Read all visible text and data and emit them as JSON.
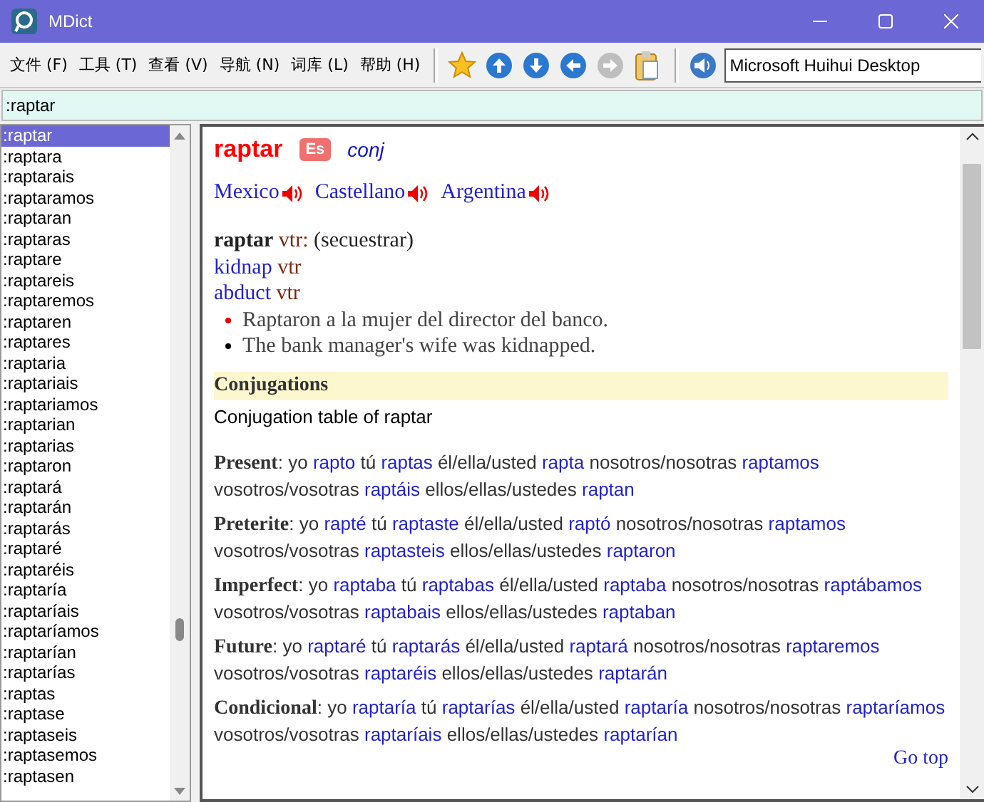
{
  "window": {
    "title": "MDict"
  },
  "menu": [
    {
      "label": "文件 (F)"
    },
    {
      "label": "工具 (T)"
    },
    {
      "label": "查看 (V)"
    },
    {
      "label": "导航 (N)"
    },
    {
      "label": "词库 (L)"
    },
    {
      "label": "帮助 (H)"
    }
  ],
  "toolbar": [
    {
      "kind": "star",
      "disabled": false
    },
    {
      "kind": "up",
      "disabled": false
    },
    {
      "kind": "down",
      "disabled": false
    },
    {
      "kind": "back",
      "disabled": false
    },
    {
      "kind": "forward",
      "disabled": true
    },
    {
      "kind": "clipboard",
      "disabled": false
    },
    {
      "kind": "speaker",
      "disabled": false
    }
  ],
  "voice_field": {
    "value": "Microsoft Huihui Desktop"
  },
  "search": {
    "value": ":raptar"
  },
  "word_list": [
    {
      "label": ":raptar",
      "selected": true
    },
    {
      "label": ":raptara",
      "selected": false
    },
    {
      "label": ":raptarais",
      "selected": false
    },
    {
      "label": ":raptaramos",
      "selected": false
    },
    {
      "label": ":raptaran",
      "selected": false
    },
    {
      "label": ":raptaras",
      "selected": false
    },
    {
      "label": ":raptare",
      "selected": false
    },
    {
      "label": ":raptareis",
      "selected": false
    },
    {
      "label": ":raptaremos",
      "selected": false
    },
    {
      "label": ":raptaren",
      "selected": false
    },
    {
      "label": ":raptares",
      "selected": false
    },
    {
      "label": ":raptaria",
      "selected": false
    },
    {
      "label": ":raptariais",
      "selected": false
    },
    {
      "label": ":raptariamos",
      "selected": false
    },
    {
      "label": ":raptarian",
      "selected": false
    },
    {
      "label": ":raptarias",
      "selected": false
    },
    {
      "label": ":raptaron",
      "selected": false
    },
    {
      "label": ":raptará",
      "selected": false
    },
    {
      "label": ":raptarán",
      "selected": false
    },
    {
      "label": ":raptarás",
      "selected": false
    },
    {
      "label": ":raptaré",
      "selected": false
    },
    {
      "label": ":raptaréis",
      "selected": false
    },
    {
      "label": ":raptaría",
      "selected": false
    },
    {
      "label": ":raptaríais",
      "selected": false
    },
    {
      "label": ":raptaríamos",
      "selected": false
    },
    {
      "label": ":raptarían",
      "selected": false
    },
    {
      "label": ":raptarías",
      "selected": false
    },
    {
      "label": ":raptas",
      "selected": false
    },
    {
      "label": ":raptase",
      "selected": false
    },
    {
      "label": ":raptaseis",
      "selected": false
    },
    {
      "label": ":raptasemos",
      "selected": false
    },
    {
      "label": ":raptasen",
      "selected": false
    }
  ],
  "entry": {
    "headword": "raptar",
    "language_badge": "Es",
    "pos_link": "conj",
    "pronunciations": [
      {
        "label": "Mexico"
      },
      {
        "label": "Castellano"
      },
      {
        "label": "Argentina"
      }
    ],
    "sense": {
      "headword": "raptar",
      "grammar": "vtr:",
      "gloss": "(secuestrar)"
    },
    "translations": [
      {
        "word": "kidnap",
        "grammar": "vtr"
      },
      {
        "word": "abduct",
        "grammar": "vtr"
      }
    ],
    "examples": [
      {
        "kind": "source",
        "text": "Raptaron a la mujer del director del banco."
      },
      {
        "kind": "translation",
        "text": "The bank manager's wife was kidnapped."
      }
    ],
    "section_heading": "Conjugations",
    "section_intro": "Conjugation table of raptar",
    "tenses": [
      {
        "label": "**Present**:",
        "forms": [
          {
            "pronoun": "yo",
            "form": "rapto"
          },
          {
            "pronoun": "tú",
            "form": "raptas"
          },
          {
            "pronoun": "él/ella/usted",
            "form": "rapta"
          },
          {
            "pronoun": "nosotros/nosotras",
            "form": "raptamos"
          },
          {
            "pronoun": "vosotros/vosotras",
            "form": "raptáis"
          },
          {
            "pronoun": "ellos/ellas/ustedes",
            "form": "raptan"
          }
        ]
      },
      {
        "label": "**Preterite**:",
        "forms": [
          {
            "pronoun": "yo",
            "form": "rapté"
          },
          {
            "pronoun": "tú",
            "form": "raptaste"
          },
          {
            "pronoun": "él/ella/usted",
            "form": "raptó"
          },
          {
            "pronoun": "nosotros/nosotras",
            "form": "raptamos"
          },
          {
            "pronoun": "vosotros/vosotras",
            "form": "raptasteis"
          },
          {
            "pronoun": "ellos/ellas/ustedes",
            "form": "raptaron"
          }
        ]
      },
      {
        "label": "**Imperfect**:",
        "forms": [
          {
            "pronoun": "yo",
            "form": "raptaba"
          },
          {
            "pronoun": "tú",
            "form": "raptabas"
          },
          {
            "pronoun": "él/ella/usted",
            "form": "raptaba"
          },
          {
            "pronoun": "nosotros/nosotras",
            "form": "raptábamos"
          },
          {
            "pronoun": "vosotros/vosotras",
            "form": "raptabais"
          },
          {
            "pronoun": "ellos/ellas/ustedes",
            "form": "raptaban"
          }
        ]
      },
      {
        "label": "**Future**:",
        "forms": [
          {
            "pronoun": "yo",
            "form": "raptaré"
          },
          {
            "pronoun": "tú",
            "form": "raptarás"
          },
          {
            "pronoun": "él/ella/usted",
            "form": "raptará"
          },
          {
            "pronoun": "nosotros/nosotras",
            "form": "raptaremos"
          },
          {
            "pronoun": "vosotros/vosotras",
            "form": "raptaréis"
          },
          {
            "pronoun": "ellos/ellas/ustedes",
            "form": "raptarán"
          }
        ]
      },
      {
        "label": "**Condicional**:",
        "forms": [
          {
            "pronoun": "yo",
            "form": "raptaría"
          },
          {
            "pronoun": "tú",
            "form": "raptarías"
          },
          {
            "pronoun": "él/ella/usted",
            "form": "raptaría"
          },
          {
            "pronoun": "nosotros/nosotras",
            "form": "raptaríamos"
          },
          {
            "pronoun": "vosotros/vosotras",
            "form": "raptaríais"
          },
          {
            "pronoun": "ellos/ellas/ustedes",
            "form": "raptarían"
          }
        ]
      }
    ],
    "go_top": "Go top"
  }
}
